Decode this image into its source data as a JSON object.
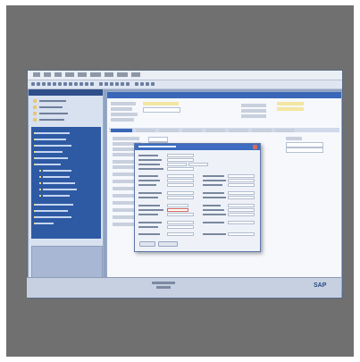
{
  "window": {
    "brand": "SAP",
    "title": "",
    "menu": [
      "",
      "",
      "",
      "",
      "",
      "",
      "",
      "",
      "",
      ""
    ]
  },
  "sidebar": {
    "title": "",
    "items": [
      "",
      "",
      "",
      "",
      "",
      "",
      "",
      "",
      "",
      "",
      "",
      "",
      "",
      "",
      "",
      ""
    ]
  },
  "main": {
    "title": "",
    "tabs": [
      "",
      "",
      "",
      "",
      "",
      "",
      "",
      ""
    ]
  },
  "dialog": {
    "title": "",
    "ok_label": "",
    "cancel_label": ""
  },
  "status": {
    "text": ""
  }
}
